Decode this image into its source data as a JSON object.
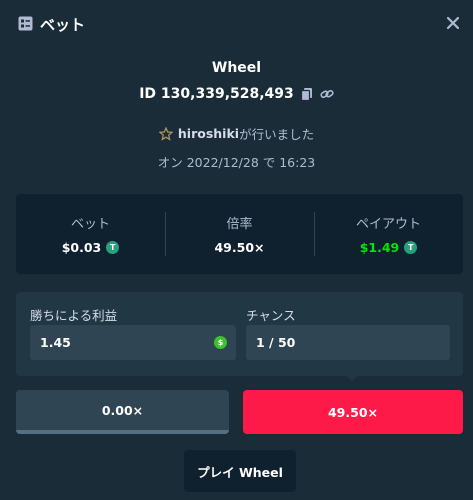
{
  "header": {
    "title": "ベット",
    "icon": "bet-slip-icon",
    "close_icon": "close-icon"
  },
  "bet": {
    "game": "Wheel",
    "id_text": "ID 130,339,528,493",
    "player": "hiroshiki",
    "player_suffix": "が行いました",
    "date_text": "オン 2022/12/28 で 16:23"
  },
  "stats": [
    {
      "label": "ベット",
      "value": "$0.03",
      "currency_icon": "tether-icon"
    },
    {
      "label": "倍率",
      "value": "49.50×"
    },
    {
      "label": "ペイアウト",
      "value": "$1.49",
      "currency_icon": "tether-icon"
    }
  ],
  "fields": {
    "profit_label": "勝ちによる利益",
    "profit_value": "1.45",
    "chance_label": "チャンス",
    "chance_value": "1 / 50"
  },
  "segments": {
    "low": "0.00×",
    "high": "49.50×"
  },
  "play_button": "プレイ Wheel",
  "colors": {
    "background": "#1a2c38",
    "panel": "#0f212e",
    "input": "#2f4553",
    "payout_green": "#00e701",
    "highlight_red": "#fe1a48",
    "tether": "#26a17b"
  }
}
